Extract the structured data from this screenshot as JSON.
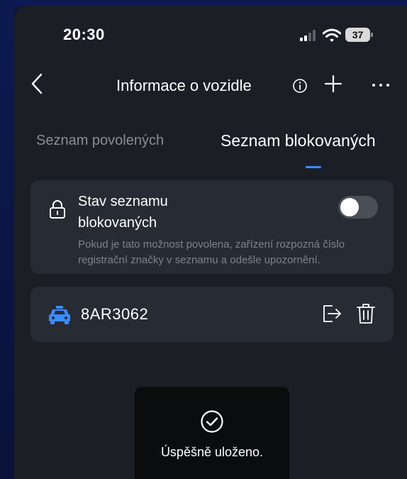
{
  "status_bar": {
    "time": "20:30",
    "battery": "37"
  },
  "nav": {
    "title": "Informace o vozidle",
    "back_icon": "chevron-left-icon",
    "info_icon": "info-circle-icon",
    "add_icon": "plus-icon",
    "more_icon": "more-dots-icon"
  },
  "tabs": [
    {
      "label": "Seznam povolených",
      "active": false
    },
    {
      "label": "Seznam blokovaných",
      "active": true
    }
  ],
  "list_status": {
    "title": "Stav seznamu blokovaných",
    "description": "Pokud je tato možnost povolena, zařízení rozpozná číslo registrační značky v seznamu a odešle upozornění.",
    "toggle_on": false,
    "icon": "lock-icon"
  },
  "plates": [
    {
      "plate": "8AR3062",
      "icon": "car-icon",
      "actions": [
        "move-to-list-icon",
        "trash-icon"
      ]
    }
  ],
  "toast": {
    "message": "Úspěšně uloženo.",
    "icon": "check-circle-icon"
  },
  "colors": {
    "background": "#1b1e25",
    "card": "#272b33",
    "accent": "#3b8cff",
    "muted_text": "#7e828a"
  }
}
